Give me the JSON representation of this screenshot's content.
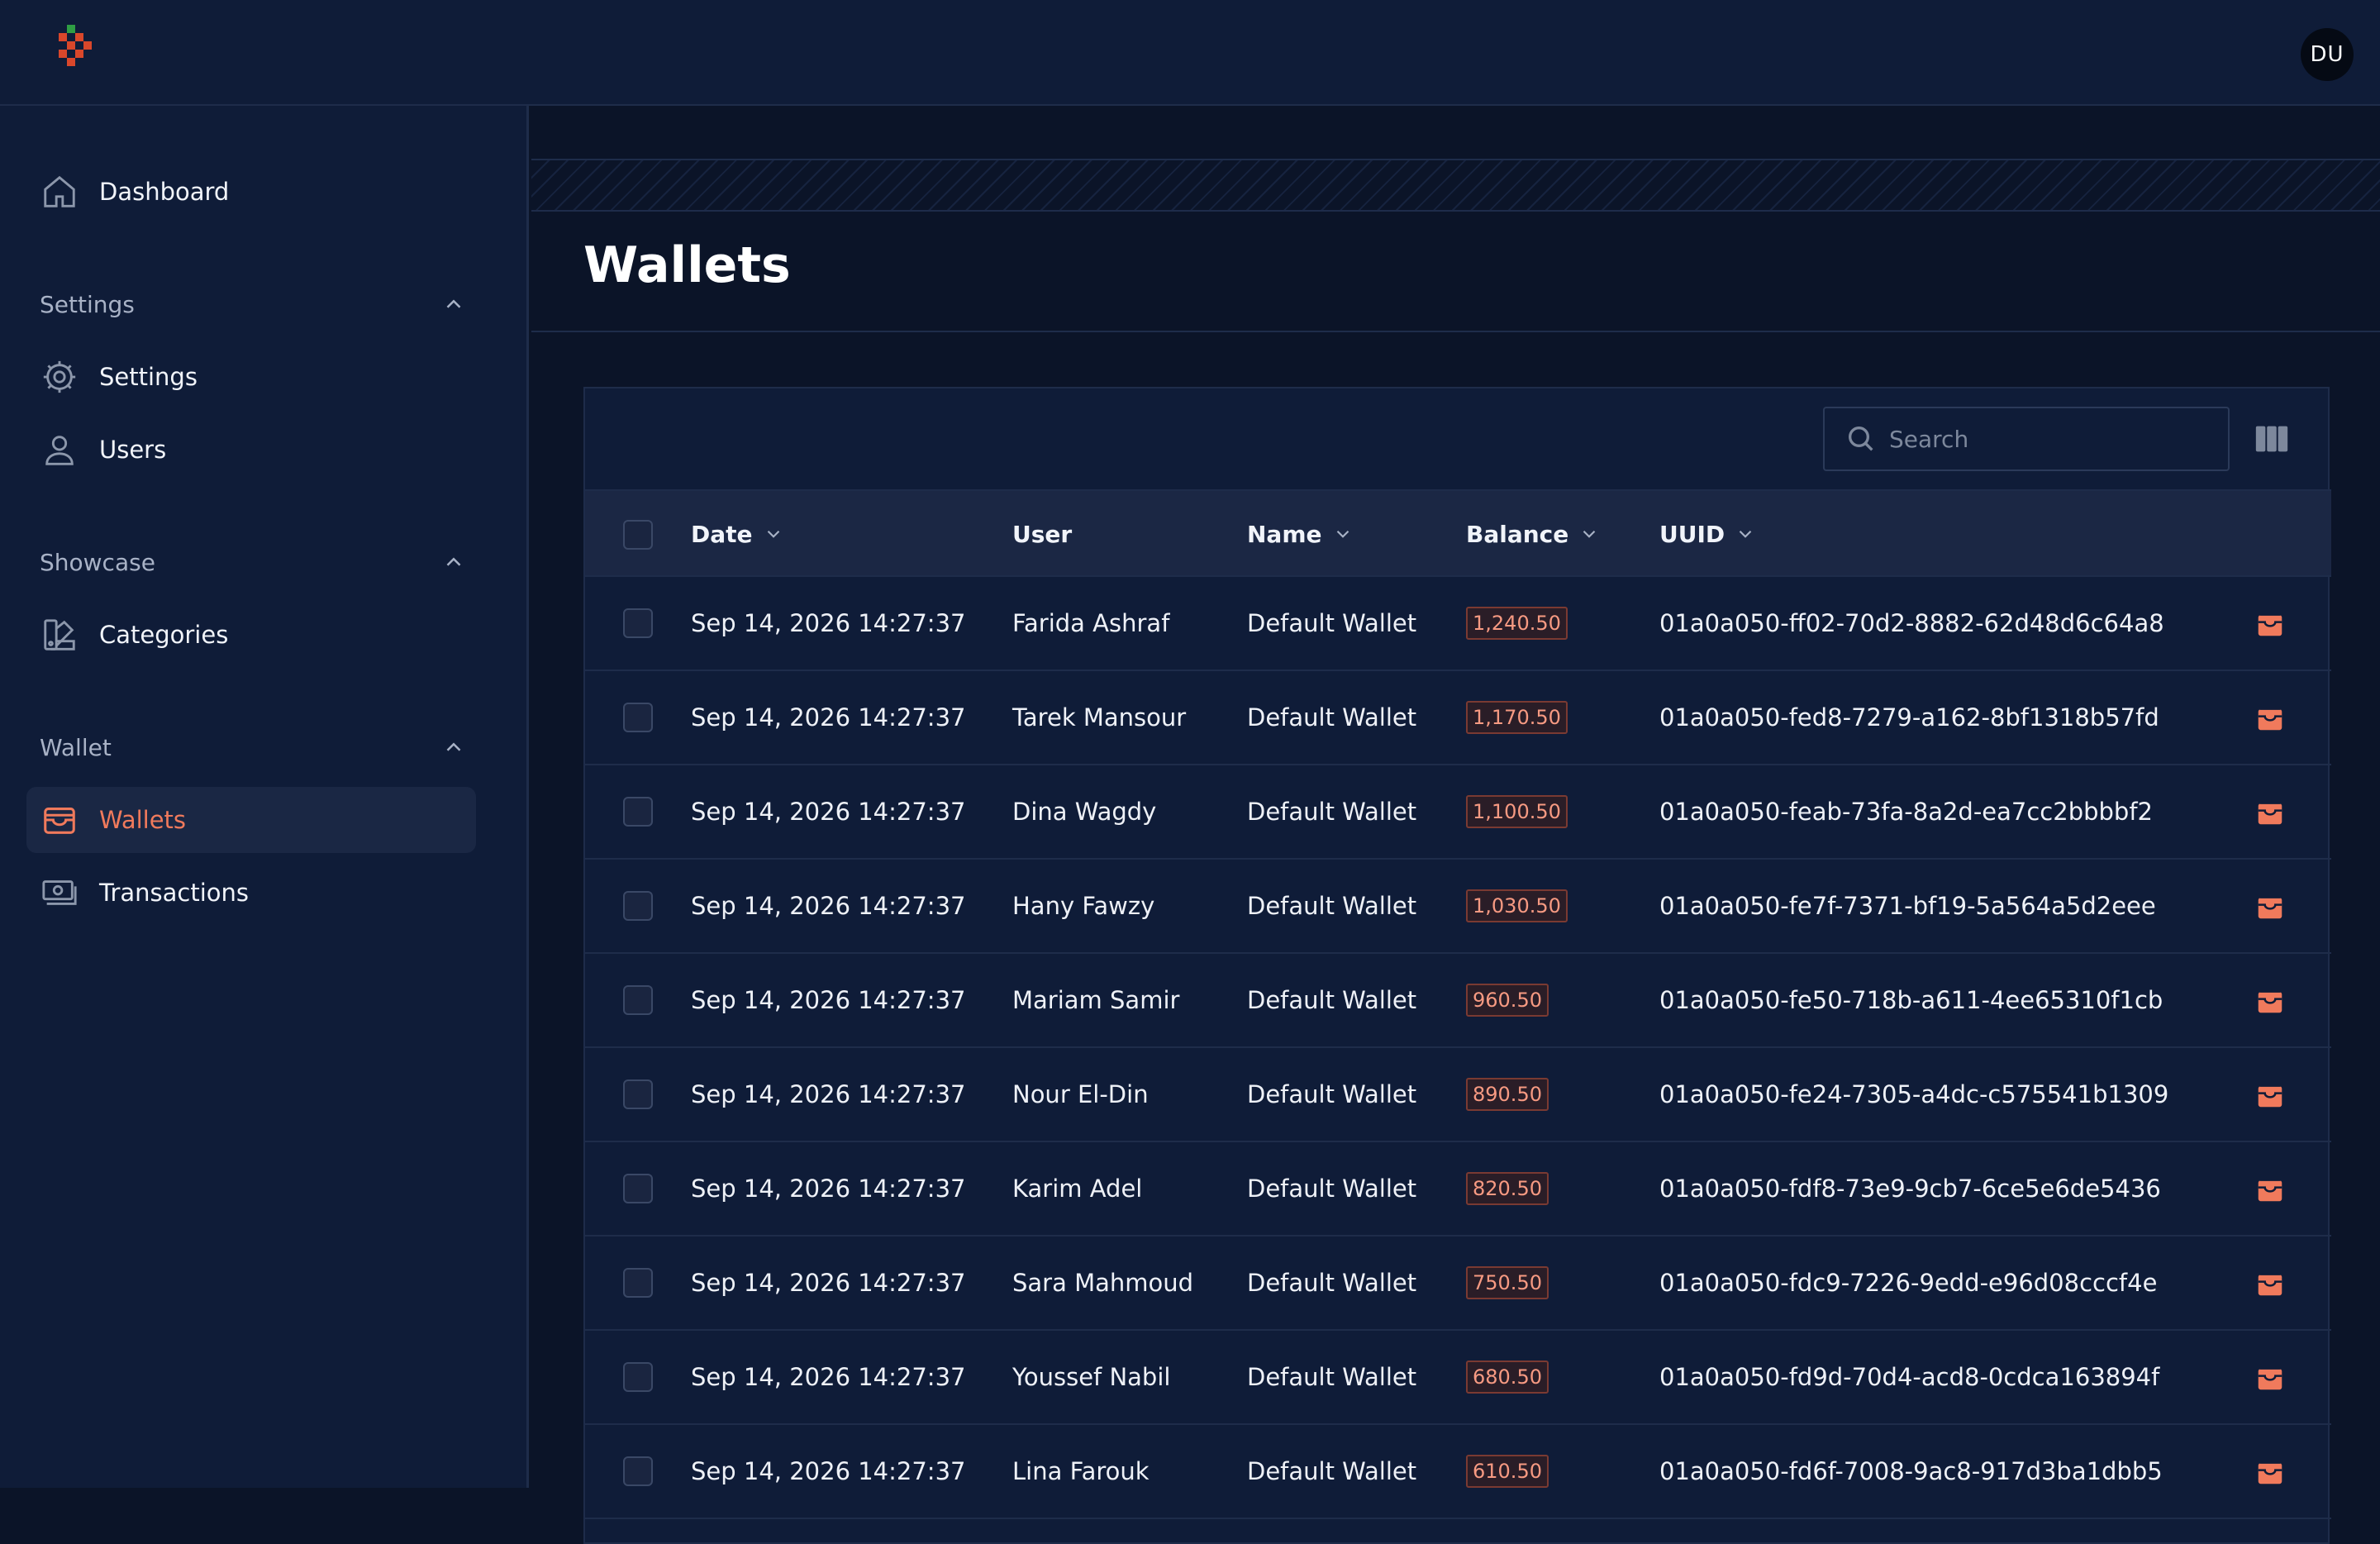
{
  "header": {
    "avatar_initials": "DU"
  },
  "sidebar": {
    "dashboard": {
      "label": "Dashboard",
      "icon": "home-icon"
    },
    "sections": [
      {
        "title": "Settings",
        "items": [
          {
            "label": "Settings",
            "icon": "gear-icon"
          },
          {
            "label": "Users",
            "icon": "user-icon"
          }
        ]
      },
      {
        "title": "Showcase",
        "items": [
          {
            "label": "Categories",
            "icon": "swatch-icon"
          }
        ]
      },
      {
        "title": "Wallet",
        "items": [
          {
            "label": "Wallets",
            "icon": "wallet-icon",
            "active": true
          },
          {
            "label": "Transactions",
            "icon": "banknote-icon"
          }
        ]
      }
    ]
  },
  "page": {
    "title": "Wallets"
  },
  "search": {
    "placeholder": "Search",
    "value": ""
  },
  "table": {
    "columns": [
      "Date",
      "User",
      "Name",
      "Balance",
      "UUID"
    ],
    "rows": [
      {
        "date": "Sep 14, 2026 14:27:37",
        "user": "Farida Ashraf",
        "name": "Default Wallet",
        "balance": "1,240.50",
        "uuid": "01a0a050-ff02-70d2-8882-62d48d6c64a8"
      },
      {
        "date": "Sep 14, 2026 14:27:37",
        "user": "Tarek Mansour",
        "name": "Default Wallet",
        "balance": "1,170.50",
        "uuid": "01a0a050-fed8-7279-a162-8bf1318b57fd"
      },
      {
        "date": "Sep 14, 2026 14:27:37",
        "user": "Dina Wagdy",
        "name": "Default Wallet",
        "balance": "1,100.50",
        "uuid": "01a0a050-feab-73fa-8a2d-ea7cc2bbbbf2"
      },
      {
        "date": "Sep 14, 2026 14:27:37",
        "user": "Hany Fawzy",
        "name": "Default Wallet",
        "balance": "1,030.50",
        "uuid": "01a0a050-fe7f-7371-bf19-5a564a5d2eee"
      },
      {
        "date": "Sep 14, 2026 14:27:37",
        "user": "Mariam Samir",
        "name": "Default Wallet",
        "balance": "960.50",
        "uuid": "01a0a050-fe50-718b-a611-4ee65310f1cb"
      },
      {
        "date": "Sep 14, 2026 14:27:37",
        "user": "Nour El-Din",
        "name": "Default Wallet",
        "balance": "890.50",
        "uuid": "01a0a050-fe24-7305-a4dc-c575541b1309"
      },
      {
        "date": "Sep 14, 2026 14:27:37",
        "user": "Karim Adel",
        "name": "Default Wallet",
        "balance": "820.50",
        "uuid": "01a0a050-fdf8-73e9-9cb7-6ce5e6de5436"
      },
      {
        "date": "Sep 14, 2026 14:27:37",
        "user": "Sara Mahmoud",
        "name": "Default Wallet",
        "balance": "750.50",
        "uuid": "01a0a050-fdc9-7226-9edd-e96d08cccf4e"
      },
      {
        "date": "Sep 14, 2026 14:27:37",
        "user": "Youssef Nabil",
        "name": "Default Wallet",
        "balance": "680.50",
        "uuid": "01a0a050-fd9d-70d4-acd8-0cdca163894f"
      },
      {
        "date": "Sep 14, 2026 14:27:37",
        "user": "Lina Farouk",
        "name": "Default Wallet",
        "balance": "610.50",
        "uuid": "01a0a050-fd6f-7008-9ac8-917d3ba1dbb5"
      }
    ]
  },
  "colors": {
    "accent": "#f07a5c",
    "sidebar_bg": "#0f1c38",
    "page_bg": "#0b1428"
  }
}
